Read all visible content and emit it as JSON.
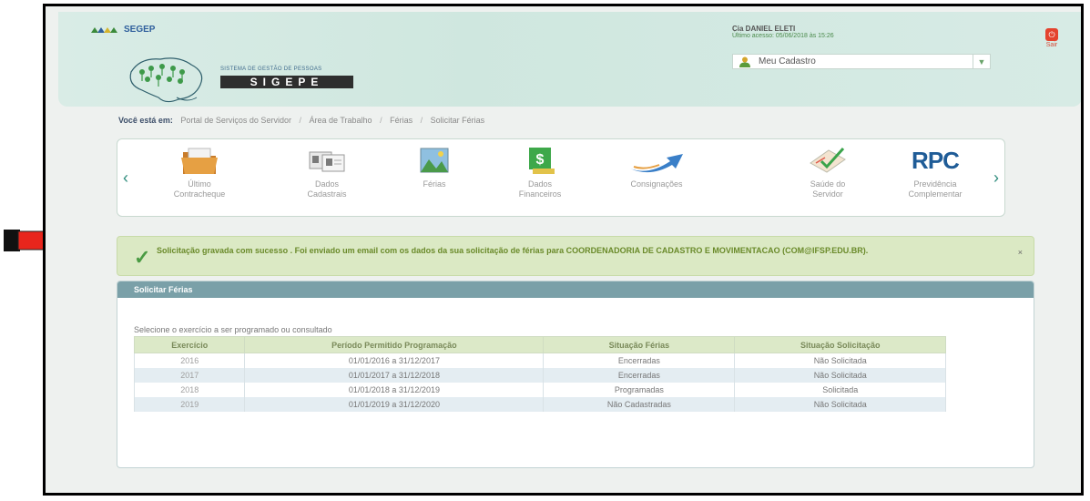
{
  "header": {
    "brand_text": "SEGEP",
    "logo_subtitle": "SISTEMA DE GESTÃO DE PESSOAS",
    "logo_text": "SIGEPE",
    "user_name": "Cia DANIEL ELETI",
    "last_access": "Último acesso: 05/06/2018 às 15:26",
    "cadastro_label": "Meu Cadastro",
    "sair_label": "Sair"
  },
  "breadcrumb": {
    "prefix": "Você está em:",
    "items": [
      "Portal de Serviços do Servidor",
      "Área de Trabalho",
      "Férias",
      "Solicitar Férias"
    ]
  },
  "carousel": {
    "items": [
      {
        "label": "Último\nContracheque",
        "icon": "folder-icon"
      },
      {
        "label": "Dados\nCadastrais",
        "icon": "id-cards-icon"
      },
      {
        "label": "Férias",
        "icon": "landscape-icon"
      },
      {
        "label": "Dados\nFinanceiros",
        "icon": "money-icon"
      },
      {
        "label": "Consignações",
        "icon": "swoosh-icon"
      },
      {
        "label": "Saúde do\nServidor",
        "icon": "health-check-icon"
      },
      {
        "label": "Previdência\nComplementar",
        "icon_text": "RPC"
      }
    ]
  },
  "success": {
    "message": "Solicitação gravada com sucesso . Foi enviado um email com os dados da sua solicitação de férias para COORDENADORIA DE CADASTRO E MOVIMENTACAO (COM@IFSP.EDU.BR).",
    "close": "×"
  },
  "panel": {
    "title": "Solicitar Férias",
    "subtitle": "Selecione o exercício a ser programado ou consultado",
    "columns": [
      "Exercício",
      "Período Permitido Programação",
      "Situação Férias",
      "Situação Solicitação"
    ],
    "rows": [
      {
        "year": "2016",
        "period": "01/01/2016 a 31/12/2017",
        "ferias": "Encerradas",
        "solicitacao": "Não Solicitada"
      },
      {
        "year": "2017",
        "period": "01/01/2017 a 31/12/2018",
        "ferias": "Encerradas",
        "solicitacao": "Não Solicitada"
      },
      {
        "year": "2018",
        "period": "01/01/2018 a 31/12/2019",
        "ferias": "Programadas",
        "solicitacao": "Solicitada"
      },
      {
        "year": "2019",
        "period": "01/01/2019 a 31/12/2020",
        "ferias": "Não Cadastradas",
        "solicitacao": "Não Solicitada"
      }
    ]
  },
  "colors": {
    "annotation_arrow": "#e8251c",
    "success_bg": "#dbe9c4",
    "panel_header": "#7aa0a8",
    "logo_blue": "#1f5c97"
  }
}
